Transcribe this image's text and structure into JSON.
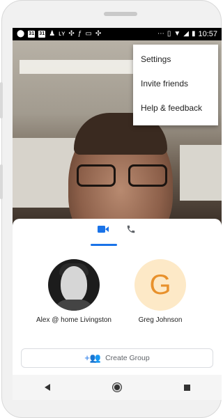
{
  "status_bar": {
    "time": "10:57",
    "left_icons": [
      "location-icon",
      "calendar-31-icon",
      "calendar-31-icon",
      "person-icon",
      "lyft-icon",
      "pinwheel-icon",
      "flow-icon",
      "screen-icon",
      "pinwheel-icon",
      "more-icon"
    ],
    "calendar_day": "31",
    "right_icons": [
      "vibrate-icon",
      "wifi-icon",
      "signal-icon",
      "battery-icon"
    ]
  },
  "menu": {
    "items": [
      {
        "label": "Settings"
      },
      {
        "label": "Invite friends"
      },
      {
        "label": "Help & feedback"
      }
    ]
  },
  "tabs": {
    "active": "video",
    "items": [
      "video-tab",
      "voice-tab"
    ]
  },
  "contacts": [
    {
      "name": "Alex @ home Livingston",
      "avatar": "photo"
    },
    {
      "name": "Greg Johnson",
      "avatar_letter": "G",
      "avatar_color": "#fde9c7",
      "letter_color": "#e8912c"
    }
  ],
  "create_group": {
    "label": "Create Group"
  },
  "colors": {
    "accent": "#1a73e8"
  }
}
